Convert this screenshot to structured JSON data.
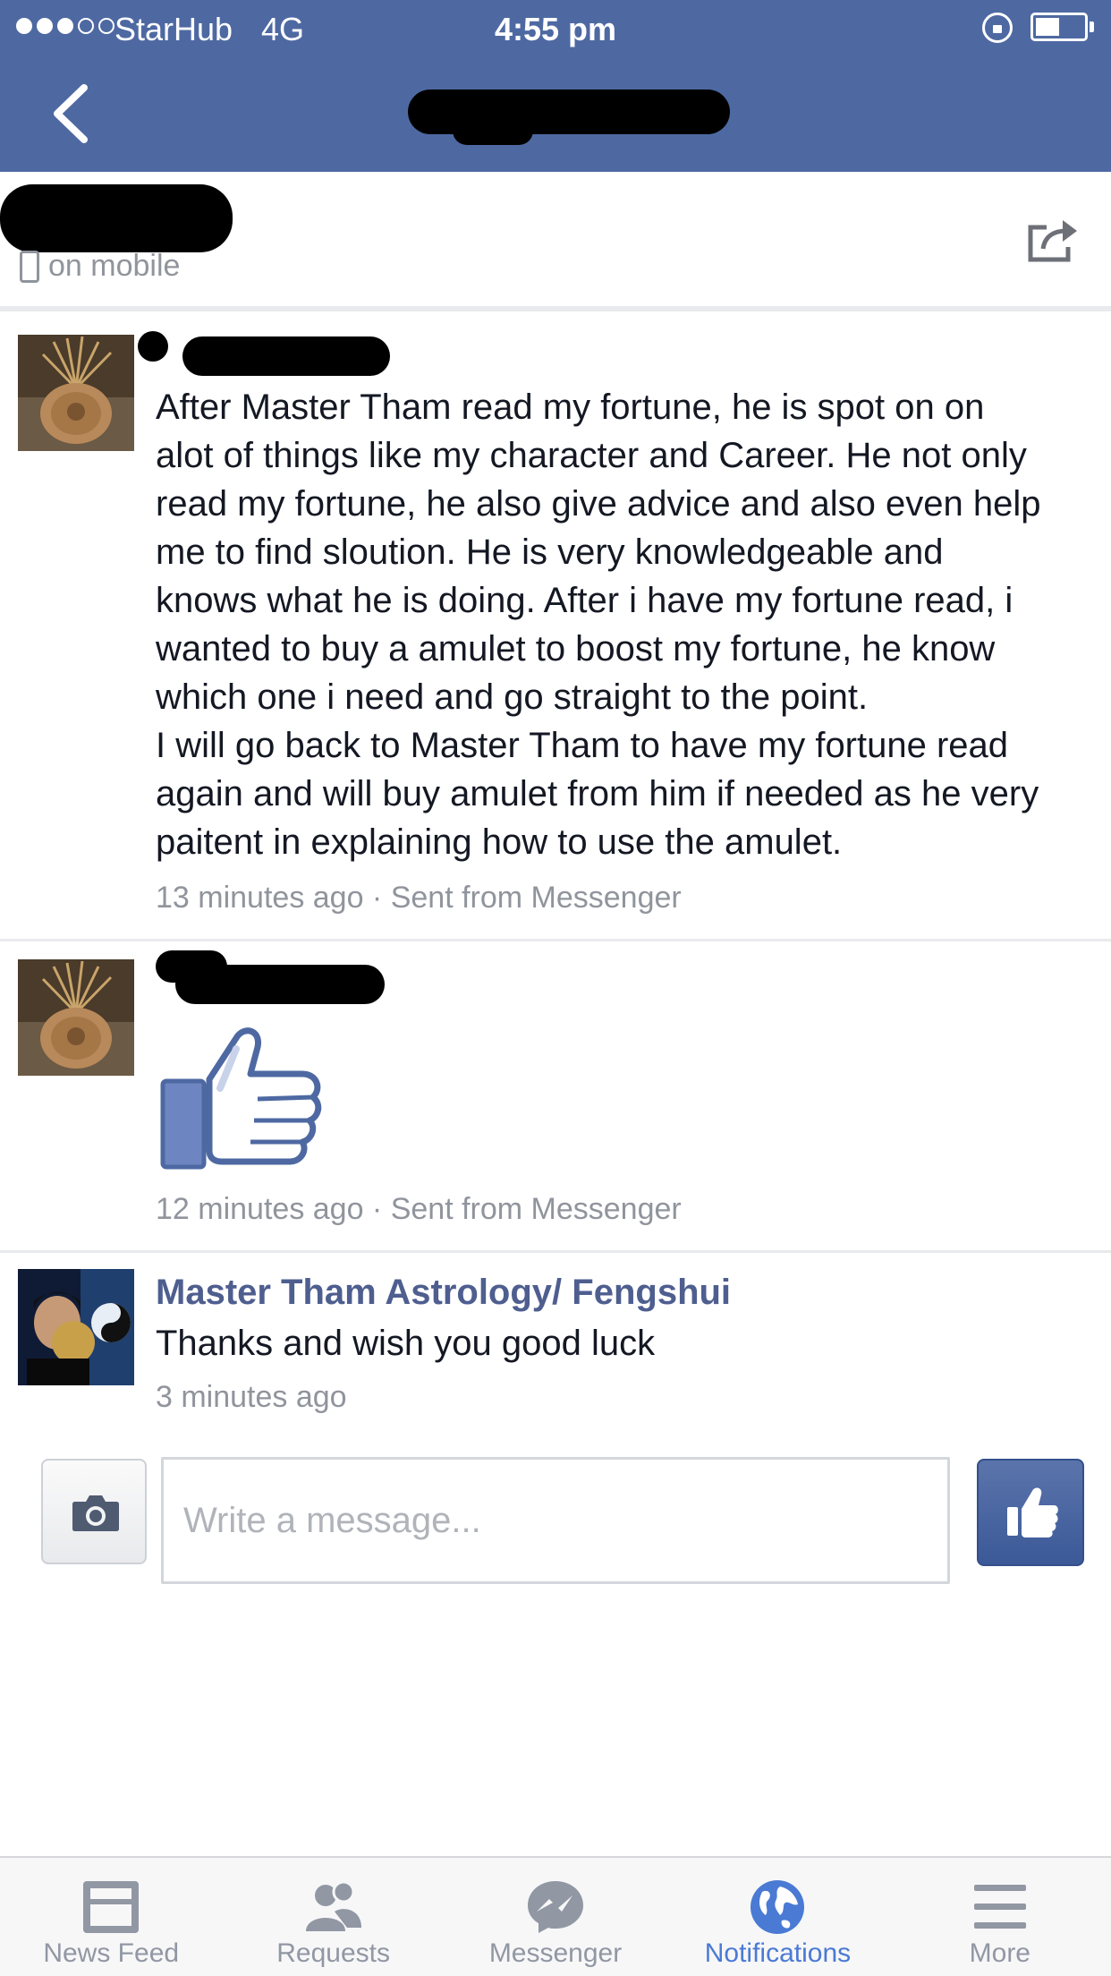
{
  "status_bar": {
    "carrier": "StarHub",
    "network": "4G",
    "time": "4:55 pm",
    "signal_bars_filled": 3,
    "signal_bars_total": 5,
    "battery_level": 0.5
  },
  "nav": {
    "back_icon": "chevron-left-icon",
    "title": ""
  },
  "conversation": {
    "status": "on mobile",
    "share_icon": "share-icon"
  },
  "messages": [
    {
      "sender": "",
      "lines": [
        "After Master Tham read my fortune, he is spot on on",
        "alot of things like my character and Career. He not only",
        "read my fortune, he also give advice and also even help",
        "me to find sloution. He is very knowledgeable and",
        "knows what he is doing. After i have my fortune read, i",
        "wanted to buy a amulet to boost my fortune, he know",
        "which one i need and go straight to the point.",
        "I will go back to Master Tham to have my fortune read",
        "again and will buy amulet from him if needed as he very",
        "paitent in explaining how to use the amulet."
      ],
      "meta": "13 minutes ago · Sent from Messenger"
    },
    {
      "sender": "",
      "sticker": "thumbs-up-sticker",
      "meta": "12 minutes ago · Sent from Messenger"
    },
    {
      "sender": "Master Tham Astrology/ Fengshui",
      "text": "Thanks and wish you good luck",
      "meta": "3 minutes ago"
    }
  ],
  "composer": {
    "placeholder": "Write a message...",
    "camera_icon": "camera-icon",
    "like_icon": "thumbs-up-icon"
  },
  "tabs": [
    {
      "label": "News Feed",
      "icon": "news-feed-icon",
      "active": false
    },
    {
      "label": "Requests",
      "icon": "friend-requests-icon",
      "active": false
    },
    {
      "label": "Messenger",
      "icon": "messenger-icon",
      "active": false
    },
    {
      "label": "Notifications",
      "icon": "globe-icon",
      "active": true
    },
    {
      "label": "More",
      "icon": "menu-icon",
      "active": false
    }
  ],
  "colors": {
    "brand_blue": "#4e69a2",
    "active_tab": "#4a7ad3",
    "meta_grey": "#90949c",
    "sender_blue": "#4e5e8f"
  }
}
